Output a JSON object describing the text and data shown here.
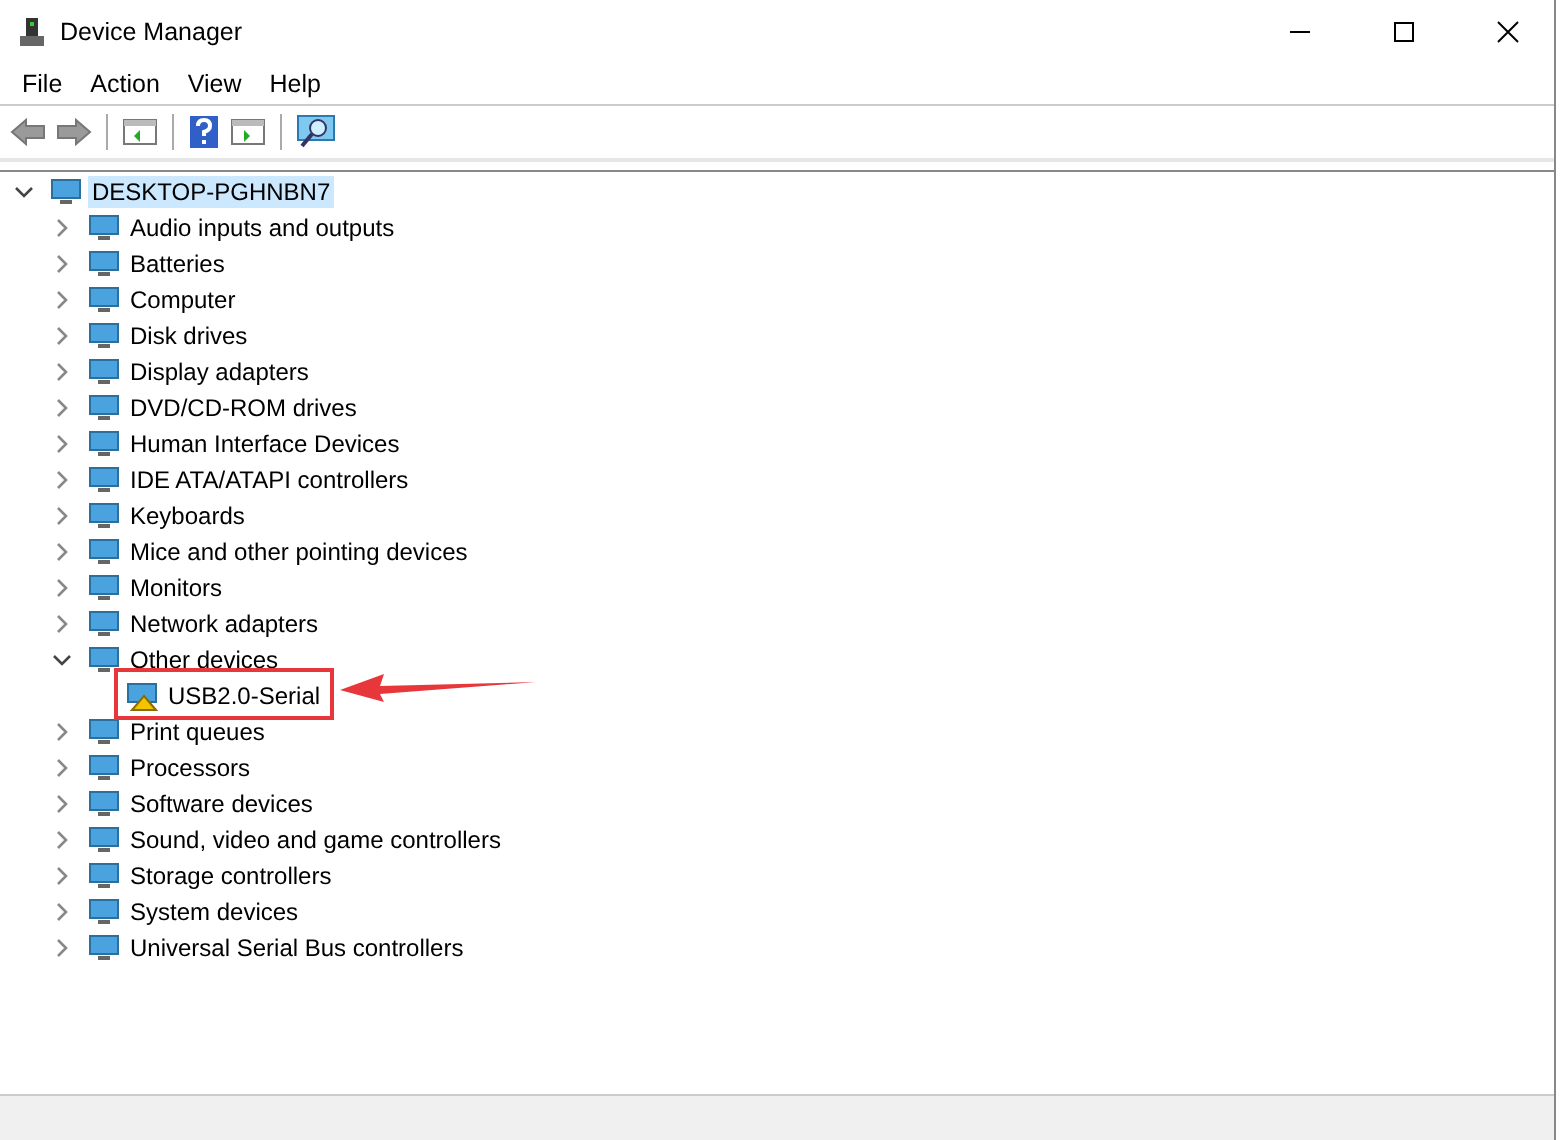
{
  "window": {
    "title": "Device Manager"
  },
  "menu": [
    "File",
    "Action",
    "View",
    "Help"
  ],
  "tree": {
    "label": "DESKTOP-PGHNBN7",
    "selected": true,
    "expanded": true,
    "children": [
      {
        "label": "Audio inputs and outputs",
        "selected": false,
        "expanded": false
      },
      {
        "label": "Batteries",
        "selected": false,
        "expanded": false
      },
      {
        "label": "Computer",
        "selected": false,
        "expanded": false
      },
      {
        "label": "Disk drives",
        "selected": false,
        "expanded": false
      },
      {
        "label": "Display adapters",
        "selected": false,
        "expanded": false
      },
      {
        "label": "DVD/CD-ROM drives",
        "selected": false,
        "expanded": false
      },
      {
        "label": "Human Interface Devices",
        "selected": false,
        "expanded": false
      },
      {
        "label": "IDE ATA/ATAPI controllers",
        "selected": false,
        "expanded": false
      },
      {
        "label": "Keyboards",
        "selected": false,
        "expanded": false
      },
      {
        "label": "Mice and other pointing devices",
        "selected": false,
        "expanded": false
      },
      {
        "label": "Monitors",
        "selected": false,
        "expanded": false
      },
      {
        "label": "Network adapters",
        "selected": false,
        "expanded": false
      },
      {
        "label": "Other devices",
        "selected": false,
        "expanded": true,
        "children": [
          {
            "label": "USB2.0-Serial",
            "selected": false,
            "warning": true
          }
        ]
      },
      {
        "label": "Print queues",
        "selected": false,
        "expanded": false
      },
      {
        "label": "Processors",
        "selected": false,
        "expanded": false
      },
      {
        "label": "Software devices",
        "selected": false,
        "expanded": false
      },
      {
        "label": "Sound, video and game controllers",
        "selected": false,
        "expanded": false
      },
      {
        "label": "Storage controllers",
        "selected": false,
        "expanded": false
      },
      {
        "label": "System devices",
        "selected": false,
        "expanded": false
      },
      {
        "label": "Universal Serial Bus controllers",
        "selected": false,
        "expanded": false
      }
    ]
  }
}
